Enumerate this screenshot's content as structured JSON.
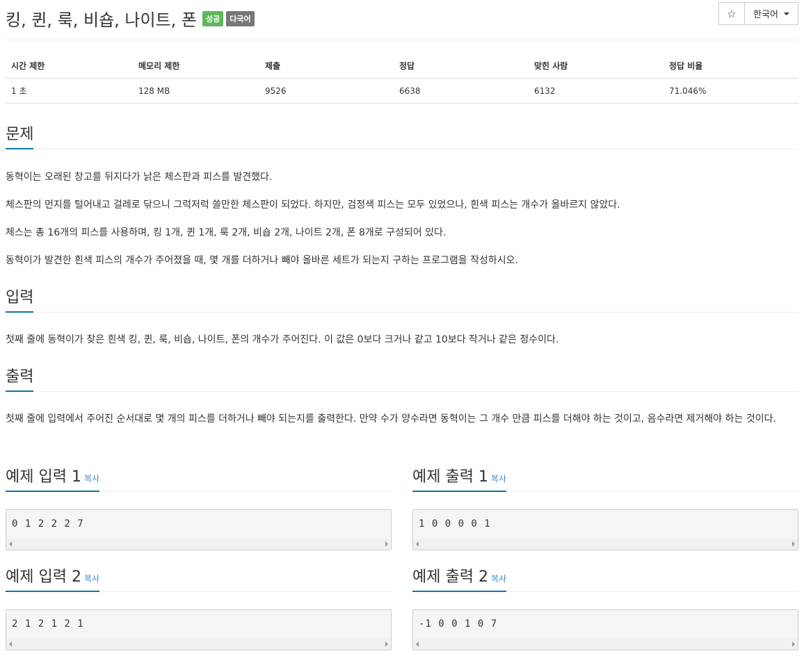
{
  "problem": {
    "title": "킹, 퀸, 룩, 비숍, 나이트, 폰",
    "badges": [
      "성공",
      "다국어"
    ]
  },
  "controls": {
    "star_icon": "☆",
    "language": "한국어"
  },
  "info_table": {
    "headers": [
      "시간 제한",
      "메모리 제한",
      "제출",
      "정답",
      "맞힌 사람",
      "정답 비율"
    ],
    "values": [
      "1 초",
      "128 MB",
      "9526",
      "6638",
      "6132",
      "71.046%"
    ]
  },
  "sections": {
    "description": {
      "heading": "문제",
      "paragraphs": [
        "동혁이는 오래된 창고를 뒤지다가 낡은 체스판과 피스를 발견했다.",
        "체스판의 먼지를 털어내고 걸레로 닦으니 그럭저럭 쓸만한 체스판이 되었다. 하지만, 검정색 피스는 모두 있었으나, 흰색 피스는 개수가 올바르지 않았다.",
        "체스는 총 16개의 피스를 사용하며, 킹 1개, 퀸 1개, 룩 2개, 비숍 2개, 나이트 2개, 폰 8개로 구성되어 있다.",
        "동혁이가 발견한 흰색 피스의 개수가 주어졌을 때, 몇 개를 더하거나 빼야 올바른 세트가 되는지 구하는 프로그램을 작성하시오."
      ]
    },
    "input": {
      "heading": "입력",
      "text": "첫째 줄에 동혁이가 찾은 흰색 킹, 퀸, 룩, 비숍, 나이트, 폰의 개수가 주어진다. 이 값은 0보다 크거나 같고 10보다 작거나 같은 정수이다."
    },
    "output": {
      "heading": "출력",
      "text": "첫째 줄에 입력에서 주어진 순서대로 몇 개의 피스를 더하거나 빼야 되는지를 출력한다. 만약 수가 양수라면 동혁이는 그 개수 만큼 피스를 더해야 하는 것이고, 음수라면 제거해야 하는 것이다."
    }
  },
  "samples": {
    "copy_label": "복사",
    "input1": {
      "heading": "예제 입력 1",
      "content": "0 1 2 2 2 7"
    },
    "output1": {
      "heading": "예제 출력 1",
      "content": "1 0 0 0 0 1"
    },
    "input2": {
      "heading": "예제 입력 2",
      "content": "2 1 2 1 2 1"
    },
    "output2": {
      "heading": "예제 출력 2",
      "content": "-1 0 0 1 0 7"
    }
  },
  "colors": {
    "success_badge": "#5cb85c",
    "default_badge": "#777777",
    "heading_underline": "#0e76a8",
    "link": "#428bca"
  }
}
